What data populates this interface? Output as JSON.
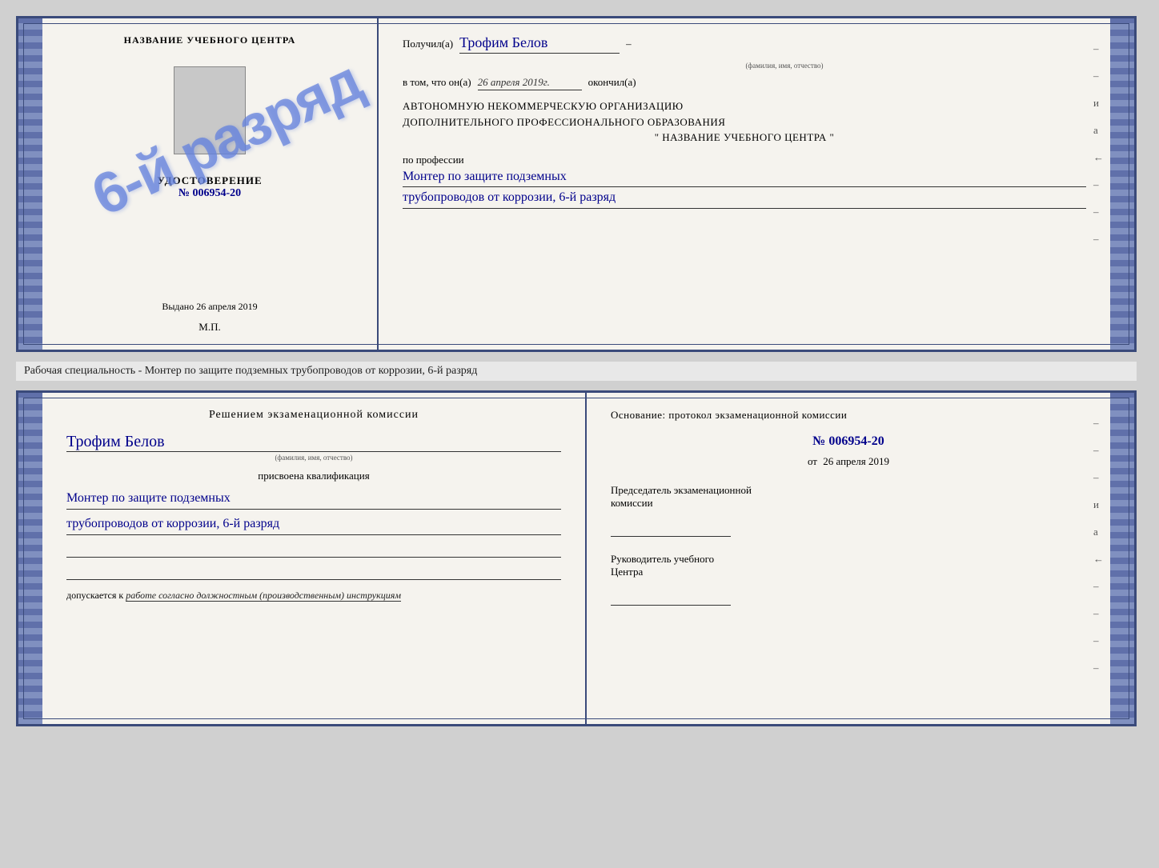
{
  "top_cert": {
    "left": {
      "title": "НАЗВАНИЕ УЧЕБНОГО ЦЕНТРА",
      "udostoverenie_label": "УДОСТОВЕРЕНИЕ",
      "number": "№ 006954-20",
      "stamp_text": "6-й разряд",
      "vidan_label": "Выдано",
      "vidan_date": "26 апреля 2019",
      "mp_label": "М.П."
    },
    "right": {
      "poluchil_label": "Получил(а)",
      "recipient_name": "Трофим Белов",
      "fio_hint": "(фамилия, имя, отчество)",
      "dash": "–",
      "vtom_label": "в том, что он(а)",
      "completion_date": "26 апреля 2019г.",
      "okonchill_label": "окончил(а)",
      "org_line1": "АВТОНОМНУЮ НЕКОММЕРЧЕСКУЮ ОРГАНИЗАЦИЮ",
      "org_line2": "ДОПОЛНИТЕЛЬНОГО ПРОФЕССИОНАЛЬНОГО ОБРАЗОВАНИЯ",
      "org_quote1": "\"",
      "org_name": "НАЗВАНИЕ УЧЕБНОГО ЦЕНТРА",
      "org_quote2": "\"",
      "po_professii_label": "по профессии",
      "profession_line1": "Монтер по защите подземных",
      "profession_line2": "трубопроводов от коррозии, 6-й разряд",
      "right_dashes": [
        "–",
        "–",
        "и",
        "а",
        "←",
        "–",
        "–",
        "–"
      ]
    }
  },
  "between_label": "Рабочая специальность - Монтер по защите подземных трубопроводов от коррозии, 6-й разряд",
  "bottom_cert": {
    "left": {
      "resheniem_label": "Решением экзаменационной комиссии",
      "name": "Трофим Белов",
      "fio_hint": "(фамилия, имя, отчество)",
      "prisvoyena_label": "присвоена квалификация",
      "qualification_line1": "Монтер по защите подземных",
      "qualification_line2": "трубопроводов от коррозии, 6-й разряд",
      "dopuskaetsya_label": "допускается к",
      "dopuskaetsya_text": "работе согласно должностным (производственным) инструкциям"
    },
    "right": {
      "osnovanie_label": "Основание: протокол экзаменационной комиссии",
      "protocol_num": "№ 006954-20",
      "ot_label": "от",
      "ot_date": "26 апреля 2019",
      "predsedatel_line1": "Председатель экзаменационной",
      "predsedatel_line2": "комиссии",
      "rukovoditel_line1": "Руководитель учебного",
      "rukovoditel_line2": "Центра",
      "right_dashes": [
        "–",
        "–",
        "–",
        "и",
        "а",
        "←",
        "–",
        "–",
        "–",
        "–"
      ]
    }
  }
}
